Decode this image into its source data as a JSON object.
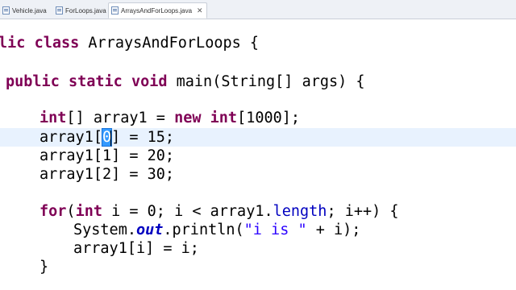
{
  "tabs": [
    {
      "label": "Vehicle.java",
      "active": false
    },
    {
      "label": "ForLoops.java",
      "active": false
    },
    {
      "label": "ArraysAndForLoops.java",
      "active": true
    }
  ],
  "tab_close_glyph": "✕",
  "colors": {
    "keyword": "#7f0055",
    "string": "#2a00ff",
    "field": "#0000c0",
    "current_line": "#e8f2fe",
    "selection": "#3399ff"
  },
  "code": {
    "class_line": {
      "kw1": "lic",
      "kw2": "class",
      "rest": " ArraysAndForLoops {"
    },
    "main_line": {
      "kw1": "public",
      "kw2": "static",
      "kw3": "void",
      "rest": " main(String[] args) {"
    },
    "decl_line": {
      "kw1": "int",
      "mid": "[] array1 = ",
      "kw2": "new",
      "kw3": "int",
      "rest": "[1000];"
    },
    "assign0": {
      "pre": "array1[",
      "selected": "0",
      "post": "] = 15;"
    },
    "assign1": "array1[1] = 20;",
    "assign2": "array1[2] = 30;",
    "for_line": {
      "kw1": "for",
      "p1": "(",
      "kw2": "int",
      "p2": " i = 0; i < array1.",
      "field": "length",
      "p3": "; i++) {"
    },
    "println_line": {
      "pre": "System.",
      "field": "out",
      "mid": ".println(",
      "str": "\"i is \"",
      "post": " + i);"
    },
    "assign_i": "array1[i] = i;",
    "close_brace": "}"
  }
}
